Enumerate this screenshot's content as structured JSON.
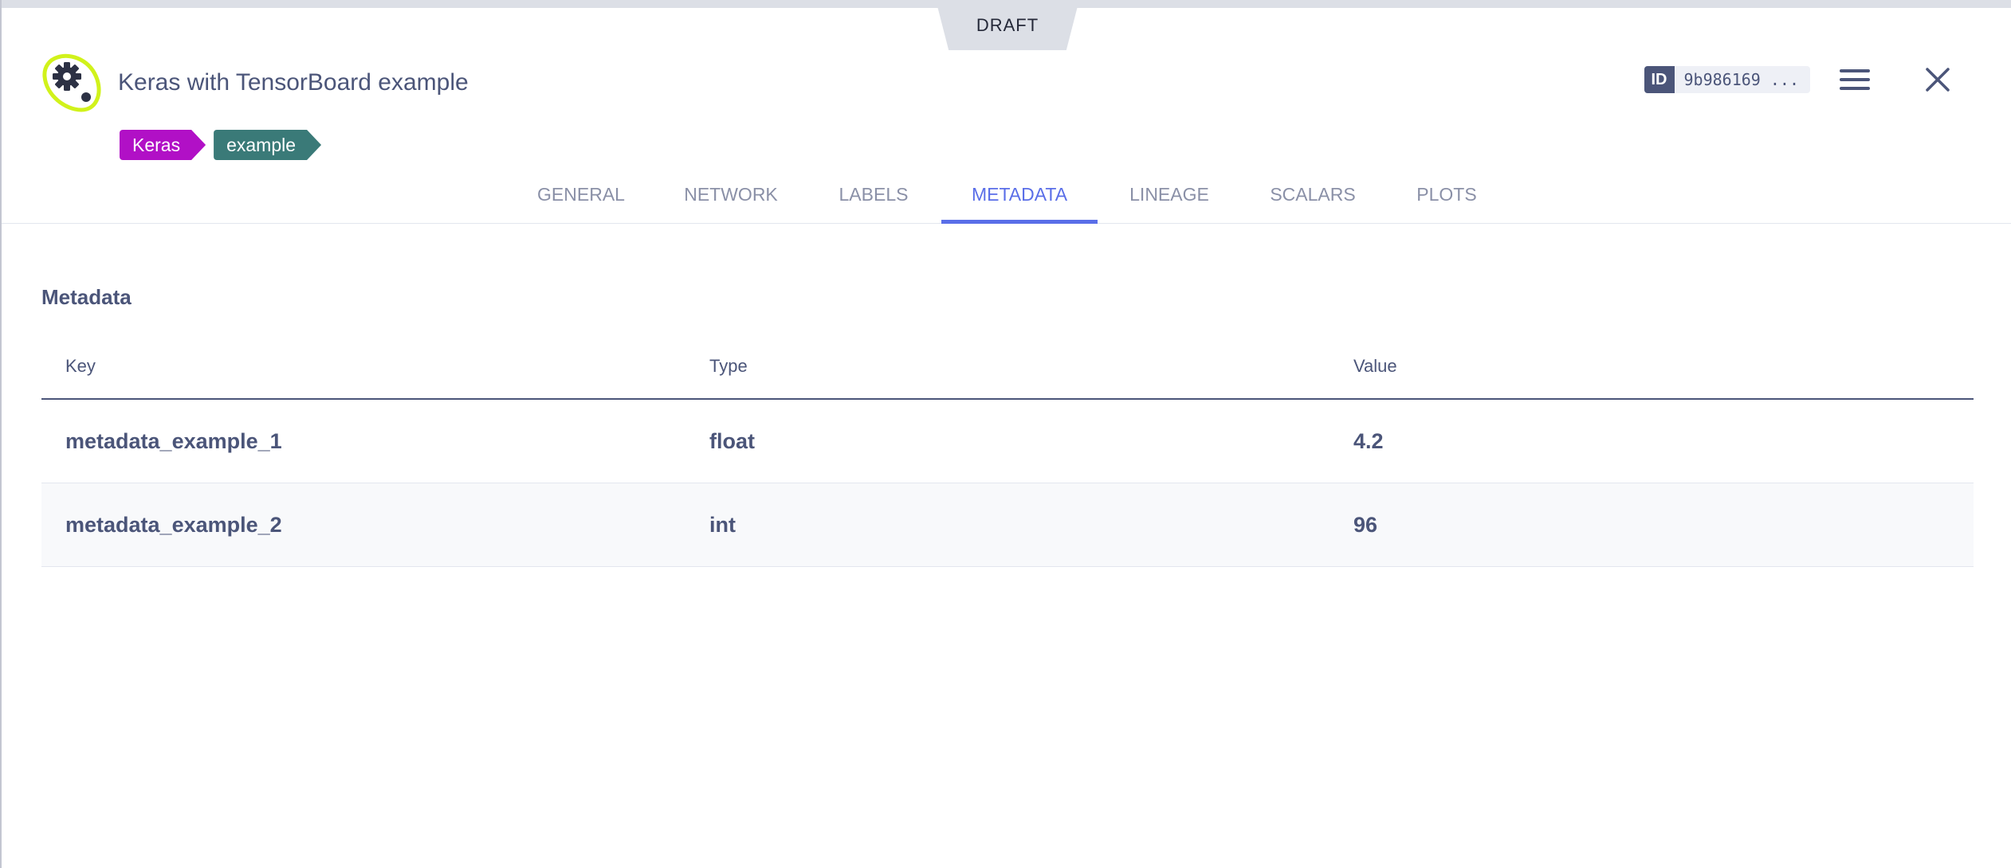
{
  "status_badge": "DRAFT",
  "model": {
    "title": "Keras with TensorBoard example",
    "icon": "model-gear-icon",
    "icon_color": "#d1f21b",
    "tags": [
      {
        "label": "Keras",
        "color": "#b110c6"
      },
      {
        "label": "example",
        "color": "#3a7a78"
      }
    ],
    "id_label": "ID",
    "id_value": "9b986169 ..."
  },
  "tabs": [
    {
      "label": "GENERAL"
    },
    {
      "label": "NETWORK"
    },
    {
      "label": "LABELS"
    },
    {
      "label": "METADATA",
      "active": true
    },
    {
      "label": "LINEAGE"
    },
    {
      "label": "SCALARS"
    },
    {
      "label": "PLOTS"
    }
  ],
  "metadata": {
    "section_title": "Metadata",
    "columns": [
      "Key",
      "Type",
      "Value"
    ],
    "rows": [
      {
        "key": "metadata_example_1",
        "type": "float",
        "value": "4.2"
      },
      {
        "key": "metadata_example_2",
        "type": "int",
        "value": "96"
      }
    ]
  },
  "colors": {
    "accent": "#5a6ee8",
    "text": "#4b5579",
    "muted": "#8a90a7"
  }
}
